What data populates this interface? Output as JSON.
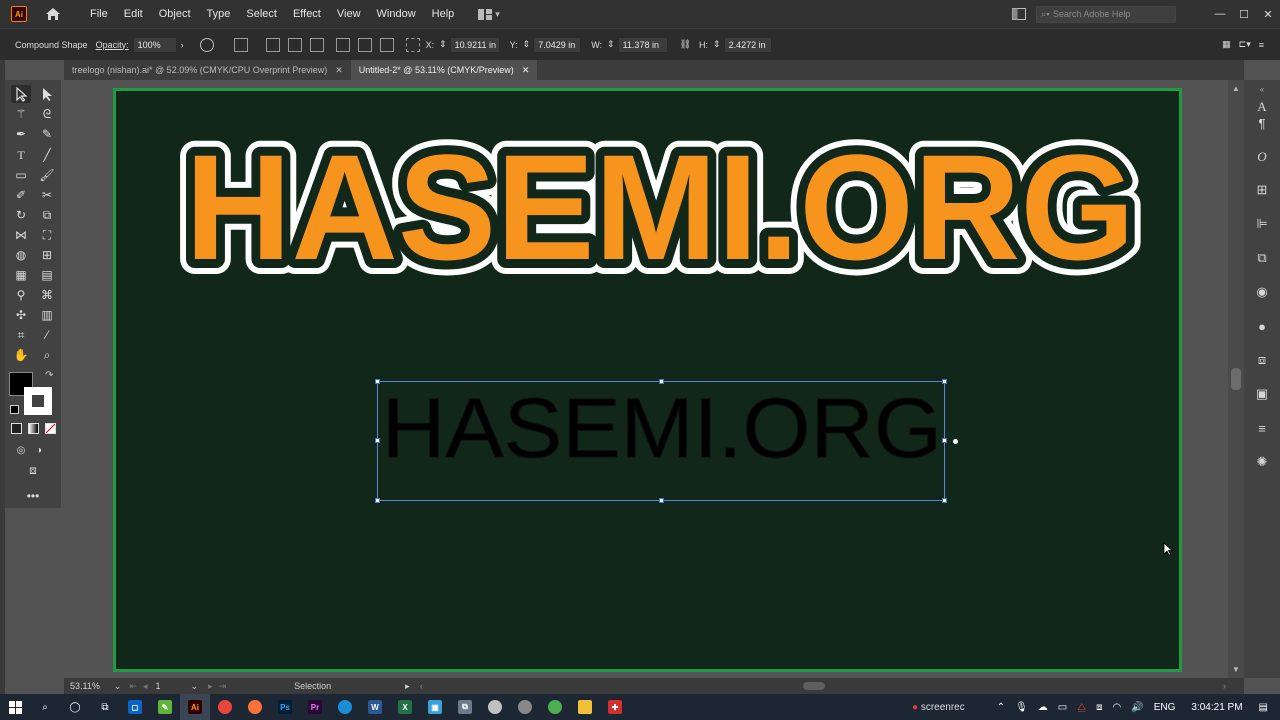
{
  "app": {
    "logo": "Ai"
  },
  "menu": [
    "File",
    "Edit",
    "Object",
    "Type",
    "Select",
    "Effect",
    "View",
    "Window",
    "Help"
  ],
  "search": {
    "placeholder": "Search Adobe Help"
  },
  "controlbar": {
    "selection_type": "Compound Shape",
    "opacity_label": "Opacity:",
    "opacity_value": "100%",
    "x_label": "X:",
    "x_value": "10.9211 in",
    "y_label": "Y:",
    "y_value": "7.0429 in",
    "w_label": "W:",
    "w_value": "11.378 in",
    "h_label": "H:",
    "h_value": "2.4272 in"
  },
  "tabs": [
    {
      "label": "treelogo (nishan).ai* @ 52.09% (CMYK/CPU Overprint Preview)",
      "active": false
    },
    {
      "label": "Untitled-2* @ 53.11% (CMYK/Preview)",
      "active": true
    }
  ],
  "canvas": {
    "logo_text": "HASEMI.ORG",
    "logo_fill": "#f7941d",
    "logo_outline": "#ffffff",
    "artboard_bg": "#10271a",
    "artboard_border": "#1f9a42",
    "selected_text": "HASEMI.ORG"
  },
  "status": {
    "zoom": "53.11%",
    "artboard_number": "1",
    "tool": "Selection"
  },
  "taskbar": {
    "language": "ENG",
    "time": "3:04:21 PM",
    "watermark": "screenrec"
  }
}
